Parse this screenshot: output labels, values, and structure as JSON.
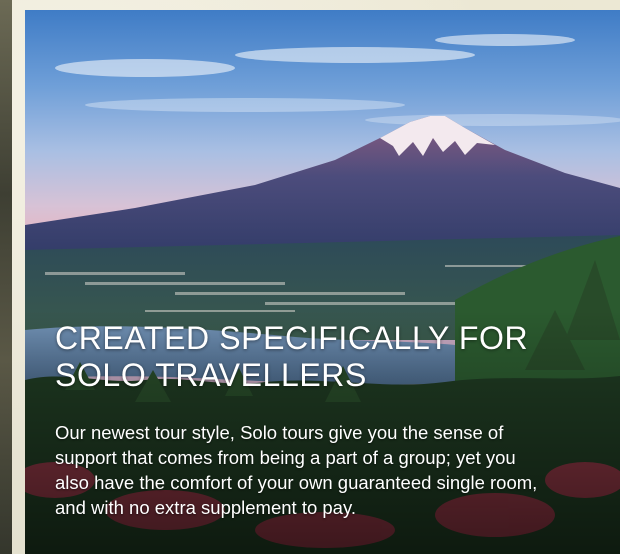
{
  "promo": {
    "headline_lines": [
      "CREATED SPECIFICALLY FOR",
      "SOLO TRAVELLERS"
    ],
    "body_lines": [
      "Our newest tour style, Solo tours give you the sense of",
      "support that comes from being a part of a group; yet you",
      "also have the comfort of your own guaranteed single room,",
      "and with no extra supplement to pay."
    ],
    "image": "mount-fuji-landscape"
  },
  "colors": {
    "text": "#ffffff",
    "sky_top": "#3f7cc6",
    "sky_pink": "#e6b6c2",
    "mountain": "#37406e",
    "snow": "#f3e9ee",
    "forest": "#1f3a22"
  }
}
